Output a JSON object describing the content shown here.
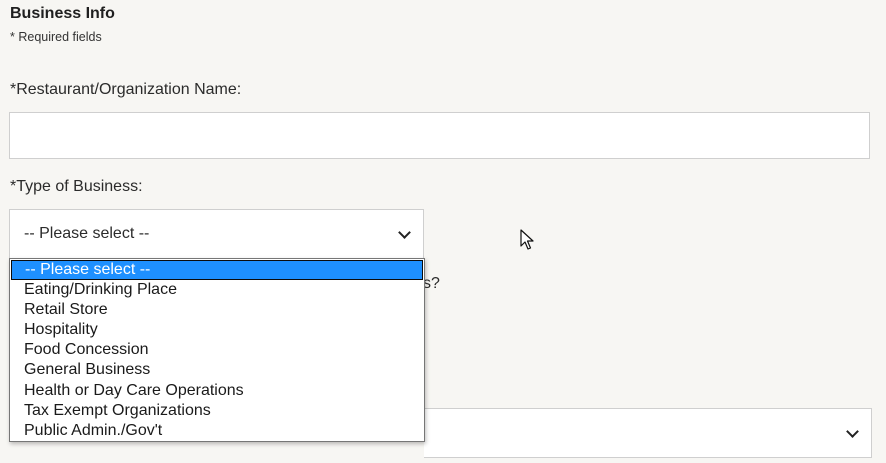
{
  "section": {
    "title": "Business Info",
    "required_note": "* Required fields"
  },
  "name_field": {
    "label": "*Restaurant/Organization Name:",
    "value": "",
    "placeholder": ""
  },
  "type_field": {
    "label": "*Type of Business:",
    "selected": "-- Please select --",
    "options": [
      "-- Please select --",
      "Eating/Drinking Place",
      "Retail Store",
      "Hospitality",
      "Food Concession",
      "General Business",
      "Health or Day Care Operations",
      "Tax Exempt Organizations",
      "Public Admin./Gov't"
    ]
  },
  "obscured": {
    "question_tail": "s?"
  },
  "colors": {
    "background": "#f7f6f3",
    "highlight": "#1e90ff",
    "border": "#cfcfcf"
  },
  "icons": {
    "chevron": "chevron-down-icon",
    "cursor": "mouse-pointer-icon"
  }
}
